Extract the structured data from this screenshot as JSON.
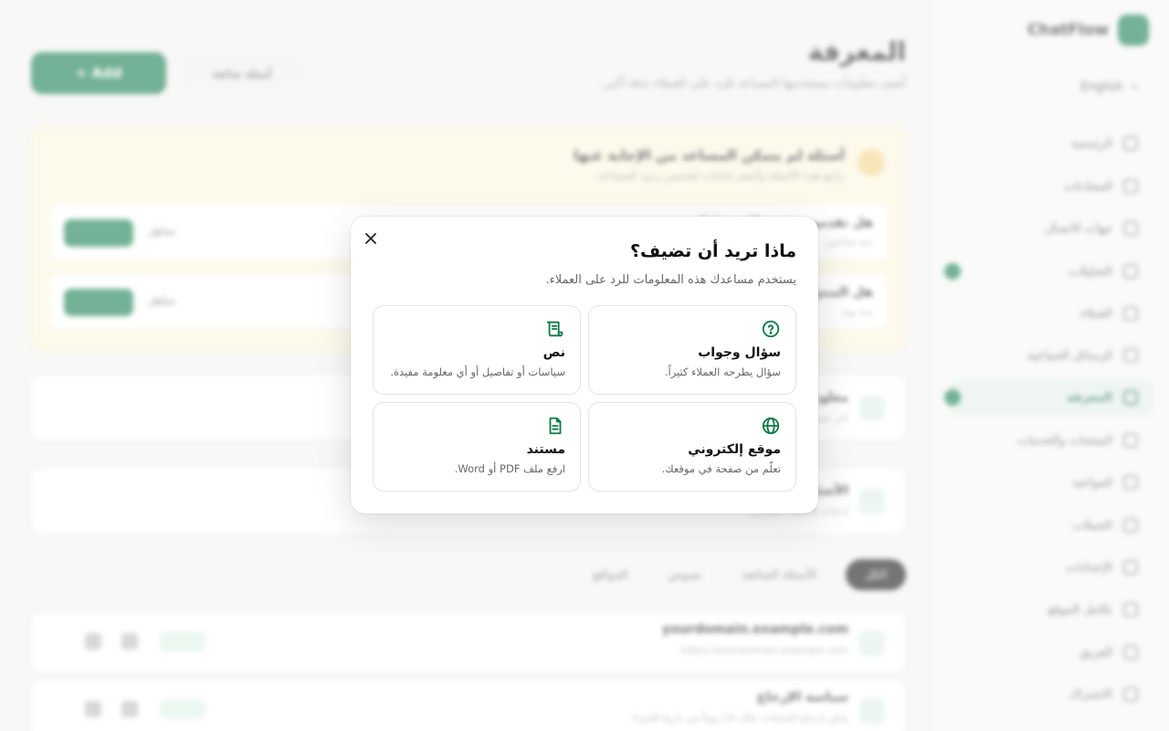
{
  "sidebar": {
    "brand": "ChatFlow",
    "language": "English",
    "items": [
      {
        "label": "الرئيسية"
      },
      {
        "label": "المحادثات"
      },
      {
        "label": "جهات الاتصال"
      },
      {
        "label": "التحليلات"
      },
      {
        "label": "العملاء"
      },
      {
        "label": "الرسائل الجماعية"
      },
      {
        "label": "المعرفة"
      },
      {
        "label": "المنتجات والخدمات"
      },
      {
        "label": "المواعيد"
      },
      {
        "label": "الحملات"
      },
      {
        "label": "الإعدادات"
      },
      {
        "label": "تكامل الموقع"
      },
      {
        "label": "الفريق"
      },
      {
        "label": "الاشتراك"
      }
    ]
  },
  "main": {
    "title": "المعرفة",
    "subtitle": "أضف معلومات يستخدمها المساعد للرد على العملاء بدقة أكبر.",
    "primary_button": "+ Add",
    "secondary_button": "أسئلة شائعة",
    "unanswered": {
      "title": "أسئلة لم يتمكن المساعد من الإجابة عنها",
      "subtitle": "راجع هذه الأسئلة وأضف إجابات لتحسين ردود المساعد.",
      "questions": [
        {
          "title": "هل تقدمون خدمة التوصيل؟",
          "meta": "منذ ساعتين",
          "answer": "أضف إجابة",
          "ignore": "تجاهل"
        },
        {
          "title": "هل المنتج متوفر بألوان أخرى؟",
          "meta": "منذ يوم",
          "answer": "أضف إجابة",
          "ignore": "تجاهل"
        }
      ]
    },
    "cards": [
      {
        "title": "معلومات عامة",
        "meta": "آخر تحديث 2026/03/05"
      },
      {
        "title": "الأسئلة الشائعة",
        "meta": "إجابات للأسئلة المتكررة"
      }
    ],
    "filters": [
      "الكل",
      "الأسئلة الشائعة",
      "نصوص",
      "المواقع"
    ],
    "rows": [
      {
        "title": "yourdomain.example.com",
        "meta": "https://yourdomain.example.com"
      },
      {
        "title": "سياسة الإرجاع",
        "meta": "يمكن إرجاع المنتجات خلال 14 يوماً من تاريخ الشراء"
      }
    ]
  },
  "modal": {
    "title": "ماذا تريد أن تضيف؟",
    "subtitle": "يستخدم مساعدك هذه المعلومات للرد على العملاء.",
    "options": [
      {
        "title": "سؤال وجواب",
        "desc": "سؤال يطرحه العملاء كثيراً.",
        "icon": "question-circle-icon"
      },
      {
        "title": "نص",
        "desc": "سياسات أو تفاصيل أو أي معلومة مفيدة.",
        "icon": "text-scroll-icon"
      },
      {
        "title": "موقع إلكتروني",
        "desc": "تعلّم من صفحة في موقعك.",
        "icon": "globe-icon"
      },
      {
        "title": "مستند",
        "desc": "ارفع ملف PDF أو Word.",
        "icon": "document-icon"
      }
    ]
  },
  "colors": {
    "accent": "#0f7a4a",
    "warning_bg": "#fbf6df"
  }
}
